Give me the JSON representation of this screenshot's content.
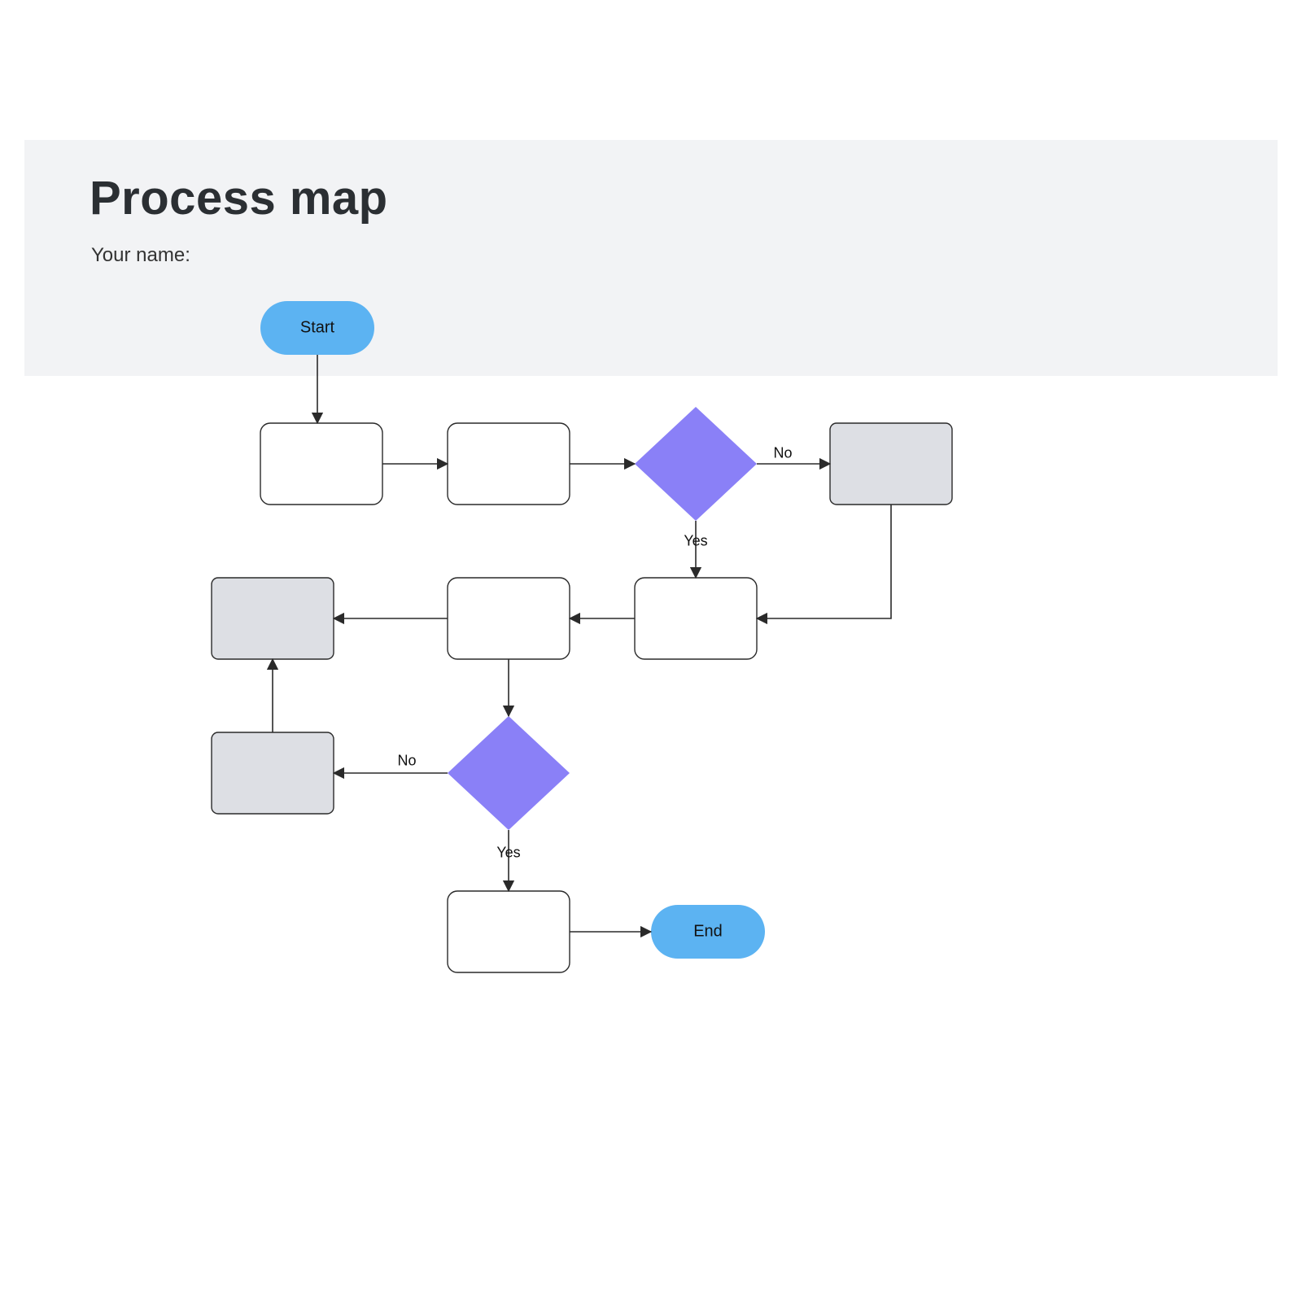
{
  "header": {
    "title": "Process map",
    "subtitle": "Your name:"
  },
  "colors": {
    "headerBg": "#f2f3f5",
    "terminator": "#5cb3f2",
    "decision": "#8a80f7",
    "subprocess": "#dddfe4",
    "stroke": "#2a2a2a"
  },
  "nodes": {
    "start": {
      "label": "Start"
    },
    "p1": {
      "label": ""
    },
    "p2": {
      "label": ""
    },
    "d1": {
      "label": ""
    },
    "s1": {
      "label": ""
    },
    "p3": {
      "label": ""
    },
    "p4": {
      "label": ""
    },
    "s2": {
      "label": ""
    },
    "s3": {
      "label": ""
    },
    "d2": {
      "label": ""
    },
    "p5": {
      "label": ""
    },
    "end": {
      "label": "End"
    }
  },
  "edges": {
    "d1_yes": "Yes",
    "d1_no": "No",
    "d2_yes": "Yes",
    "d2_no": "No"
  }
}
